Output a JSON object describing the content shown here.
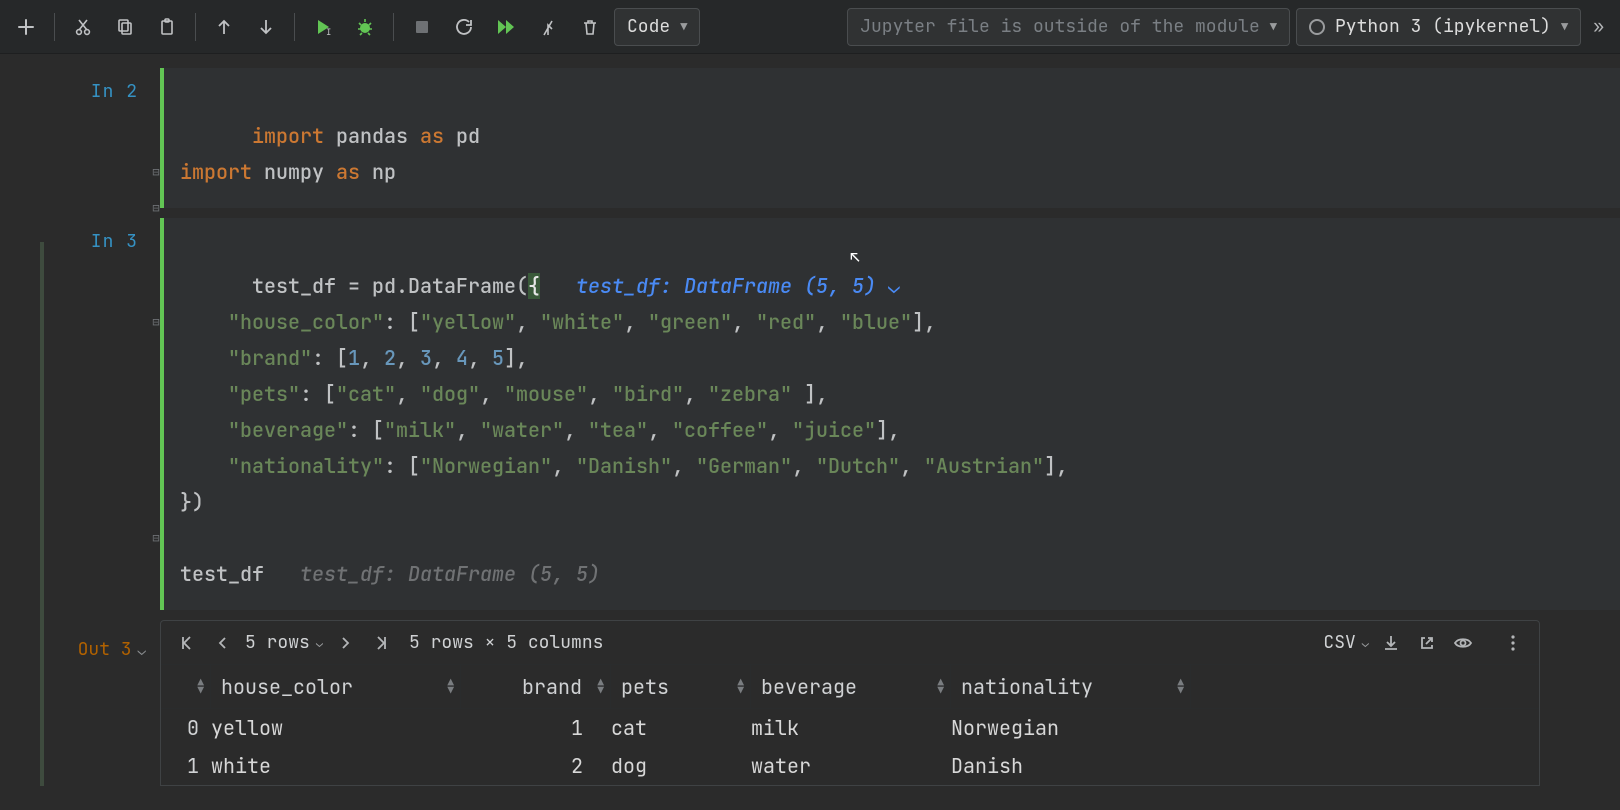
{
  "toolbar": {
    "cell_type": "Code",
    "module_msg": "Jupyter file is outside of the module",
    "kernel": "Python 3 (ipykernel)"
  },
  "cells": {
    "in2": {
      "label": "In 2",
      "line1_tokens": {
        "kw1": "import",
        "id1": "pandas",
        "as": "as",
        "id2": "pd"
      },
      "line2_tokens": {
        "kw1": "import",
        "id1": "numpy",
        "as": "as",
        "id2": "np"
      }
    },
    "in3": {
      "label": "In 3",
      "hint1": "test_df: DataFrame (5, 5)",
      "hint2": "test_df: DataFrame (5, 5)",
      "tok": {
        "l1a": "test_df = pd.DataFrame(",
        "l1b": "{",
        "k1": "\"house_color\"",
        "c1": ": [",
        "v1": "\"yellow\"",
        "v2": "\"white\"",
        "v3": "\"green\"",
        "v4": "\"red\"",
        "v5": "\"blue\"",
        "e1": "],",
        "k2": "\"brand\"",
        "c2": ": [",
        "n1": "1",
        "n2": "2",
        "n3": "3",
        "n4": "4",
        "n5": "5",
        "e2": "],",
        "k3": "\"pets\"",
        "c3": ": [",
        "p1": "\"cat\"",
        "p2": "\"dog\"",
        "p3": "\"mouse\"",
        "p4": "\"bird\"",
        "p5": "\"zebra\"",
        "e3": " ],",
        "k4": "\"beverage\"",
        "c4": ": [",
        "b1": "\"milk\"",
        "b2": "\"water\"",
        "b3": "\"tea\"",
        "b4": "\"coffee\"",
        "b5": "\"juice\"",
        "e4": "],",
        "k5": "\"nationality\"",
        "c5": ": [",
        "x1": "\"Norwegian\"",
        "x2": "\"Danish\"",
        "x3": "\"German\"",
        "x4": "\"Dutch\"",
        "x5": "\"Austrian\"",
        "e5": "],",
        "close": "})",
        "call": "test_df"
      }
    },
    "out3": {
      "label": "Out 3"
    }
  },
  "output": {
    "pager": {
      "rows_label": "5 rows",
      "summary": "5 rows × 5 columns"
    },
    "export": "CSV",
    "columns": [
      "",
      "house_color",
      "brand",
      "pets",
      "beverage",
      "nationality"
    ],
    "rows": [
      {
        "idx": "0",
        "house_color": "yellow",
        "brand": "1",
        "pets": "cat",
        "beverage": "milk",
        "nationality": "Norwegian"
      },
      {
        "idx": "1",
        "house_color": "white",
        "brand": "2",
        "pets": "dog",
        "beverage": "water",
        "nationality": "Danish"
      }
    ]
  },
  "sep": ", "
}
